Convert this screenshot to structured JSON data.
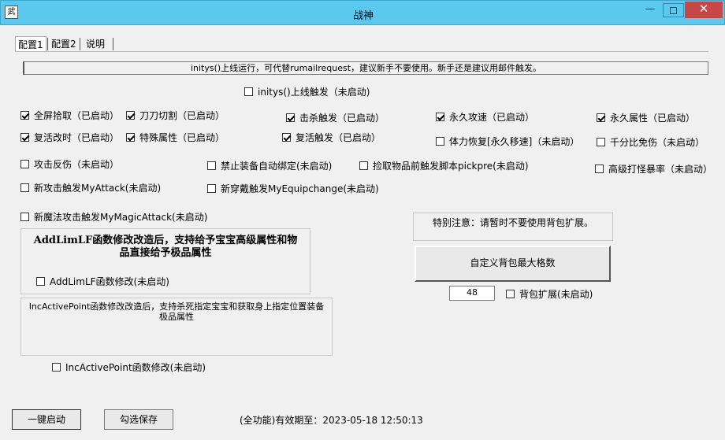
{
  "window": {
    "title": "战神",
    "icon_char": "武",
    "min": "—",
    "max": "☐",
    "close": "✕"
  },
  "tabs": [
    "配置1",
    "配置2",
    "说明"
  ],
  "notice": "initys()上线运行，可代替rumailrequest，建议新手不要使用。新手还是建议用邮件触发。",
  "checkboxes": [
    {
      "label": "initys()上线触发（未启动)",
      "checked": false
    },
    {
      "label": "全屏拾取（已启动）",
      "checked": true
    },
    {
      "label": "刀刀切割（已启动）",
      "checked": true
    },
    {
      "label": "击杀触发（已启动）",
      "checked": true
    },
    {
      "label": "永久攻速（已启动）",
      "checked": true
    },
    {
      "label": "永久属性（已启动）",
      "checked": true
    },
    {
      "label": "复活改时（已启动）",
      "checked": true
    },
    {
      "label": "特殊属性（已启动）",
      "checked": true
    },
    {
      "label": "复活触发（已启动）",
      "checked": true
    },
    {
      "label": "体力恢复[永久移速]（未启动）",
      "checked": false
    },
    {
      "label": "千分比免伤（未启动）",
      "checked": false
    },
    {
      "label": "攻击反伤（未启动）",
      "checked": false
    },
    {
      "label": "禁止装备自动绑定(未启动)",
      "checked": false
    },
    {
      "label": "捡取物品前触发脚本pickpre(未启动)",
      "checked": false
    },
    {
      "label": "高级打怪暴率（未启动）",
      "checked": false
    },
    {
      "label": "新攻击触发MyAttack(未启动)",
      "checked": false
    },
    {
      "label": "新穿戴触发MyEquipchange(未启动)",
      "checked": false
    },
    {
      "label": "新魔法攻击触发MyMagicAttack(未启动)",
      "checked": false
    },
    {
      "label": "AddLimLF函数修改(未启动)",
      "checked": false
    },
    {
      "label": "IncActivePoint函数修改(未启动)",
      "checked": false
    },
    {
      "label": "背包扩展(未启动)",
      "checked": false
    }
  ],
  "addlim_panel": {
    "title_line1": "AddLimLF函数修改改造后，支持给予宝宝高级属性和物",
    "title_line2": "品直接给予极品属性"
  },
  "incactive_panel": {
    "text_line1": "IncActivePoint函数修改改造后，支持杀死指定宝宝和获取身上指定位置装备",
    "text_line2": "极品属性"
  },
  "special_note": "特别注意：请暂时不要使用背包扩展。",
  "bag_button": "自定义背包最大格数",
  "bag_value": "48",
  "buttons": {
    "start": "一键启动",
    "save": "勾选保存"
  },
  "status": "(全功能)有效期至：2023-05-18 12:50:13"
}
